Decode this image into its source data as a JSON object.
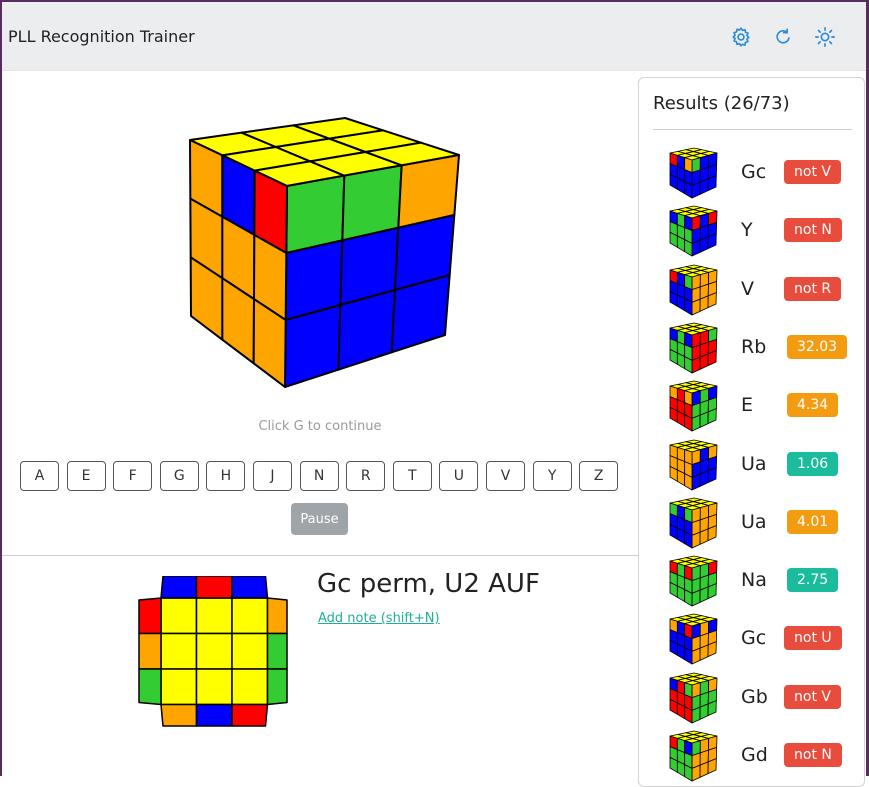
{
  "app": {
    "title": "PLL Recognition Trainer",
    "toolbar": [
      {
        "name": "settings-gear-icon",
        "icon": "gear"
      },
      {
        "name": "reset-icon",
        "icon": "refresh"
      },
      {
        "name": "theme-sun-icon",
        "icon": "sun"
      }
    ],
    "accent": "#2b8ad9"
  },
  "colors": {
    "Y": "#ffff00",
    "B": "#0000ff",
    "R": "#ff0000",
    "G": "#33cc33",
    "O": "#ffa500"
  },
  "trainer": {
    "cube": {
      "top": [
        "Y",
        "Y",
        "Y",
        "Y",
        "Y",
        "Y",
        "Y",
        "Y",
        "Y"
      ],
      "right": [
        "G",
        "G",
        "O",
        "B",
        "B",
        "B",
        "B",
        "B",
        "B"
      ],
      "left": [
        "O",
        "B",
        "R",
        "O",
        "O",
        "O",
        "O",
        "O",
        "O"
      ]
    },
    "hint": "Click G to continue",
    "letters": [
      "A",
      "E",
      "F",
      "G",
      "H",
      "J",
      "N",
      "R",
      "T",
      "U",
      "V",
      "Y",
      "Z"
    ],
    "pause_label": "Pause"
  },
  "case": {
    "title": "Gc perm, U2 AUF",
    "note_link": "Add note (shift+N)",
    "net": {
      "top_edge": [
        "B",
        "R",
        "B"
      ],
      "bottom_edge": [
        "O",
        "B",
        "R"
      ],
      "left_edge": [
        "R",
        "O",
        "G"
      ],
      "right_edge": [
        "O",
        "G",
        "G"
      ]
    }
  },
  "results": {
    "title": "Results (26/73)",
    "items": [
      {
        "name": "Gc",
        "badge": "not V",
        "status": "wrong",
        "front": [
          "G",
          "B",
          "B"
        ],
        "left": [
          "R",
          "B",
          "O"
        ]
      },
      {
        "name": "Y",
        "badge": "not N",
        "status": "wrong",
        "front": [
          "R",
          "B",
          "R"
        ],
        "left": [
          "B",
          "G",
          "B"
        ]
      },
      {
        "name": "V",
        "badge": "not R",
        "status": "wrong",
        "front": [
          "O",
          "O",
          "O"
        ],
        "left": [
          "R",
          "B",
          "G"
        ]
      },
      {
        "name": "Rb",
        "badge": "32.03",
        "status": "slow",
        "front": [
          "R",
          "R",
          "G"
        ],
        "left": [
          "B",
          "G",
          "B"
        ]
      },
      {
        "name": "E",
        "badge": "4.34",
        "status": "slow",
        "front": [
          "B",
          "G",
          "B"
        ],
        "left": [
          "O",
          "R",
          "O"
        ]
      },
      {
        "name": "Ua",
        "badge": "1.06",
        "status": "good",
        "front": [
          "O",
          "B",
          "O"
        ],
        "left": [
          "O",
          "O",
          "O"
        ]
      },
      {
        "name": "Ua",
        "badge": "4.01",
        "status": "slow",
        "front": [
          "O",
          "O",
          "O"
        ],
        "left": [
          "G",
          "B",
          "G"
        ]
      },
      {
        "name": "Na",
        "badge": "2.75",
        "status": "good",
        "front": [
          "G",
          "G",
          "R"
        ],
        "left": [
          "R",
          "G",
          "R"
        ]
      },
      {
        "name": "Gc",
        "badge": "not U",
        "status": "wrong",
        "front": [
          "B",
          "O",
          "B"
        ],
        "left": [
          "O",
          "B",
          "R"
        ]
      },
      {
        "name": "Gb",
        "badge": "not V",
        "status": "wrong",
        "front": [
          "O",
          "G",
          "O"
        ],
        "left": [
          "B",
          "R",
          "G"
        ]
      },
      {
        "name": "Gd",
        "badge": "not N",
        "status": "wrong",
        "front": [
          "G",
          "O",
          "O"
        ],
        "left": [
          "R",
          "G",
          "B"
        ]
      }
    ],
    "status_colors": {
      "wrong": "#e74c3c",
      "slow": "#f39c12",
      "good": "#1abc9c"
    }
  }
}
